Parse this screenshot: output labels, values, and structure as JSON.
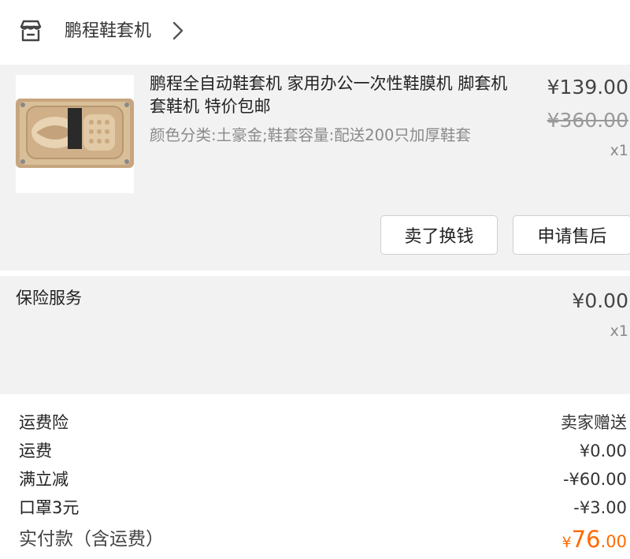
{
  "shop": {
    "name": "鹏程鞋套机",
    "icon": "shop-icon",
    "chevron": "chevron-right-icon"
  },
  "product": {
    "title": "鹏程全自动鞋套机 家用办公一次性鞋膜机 脚套机 套鞋机 特价包邮",
    "spec": "颜色分类:土豪金;鞋套容量:配送200只加厚鞋套",
    "price": "¥139.00",
    "original_price": "¥360.00",
    "quantity": "x1",
    "actions": {
      "resell": "卖了换钱",
      "after_sale": "申请售后"
    }
  },
  "insurance": {
    "label": "保险服务",
    "price": "¥0.00",
    "quantity": "x1"
  },
  "summary": {
    "rows": [
      {
        "label": "运费险",
        "value": "卖家赠送"
      },
      {
        "label": "运费",
        "value": "¥0.00"
      },
      {
        "label": "满立减",
        "value": "-¥60.00"
      },
      {
        "label": "口罩3元",
        "value": "-¥3.00"
      }
    ],
    "total_label": "实付款（含运费）",
    "total_currency": "¥",
    "total_integer": "76",
    "total_decimal": ".00"
  },
  "colors": {
    "accent": "#ff6a00",
    "card_bg": "#f2f2f2"
  }
}
